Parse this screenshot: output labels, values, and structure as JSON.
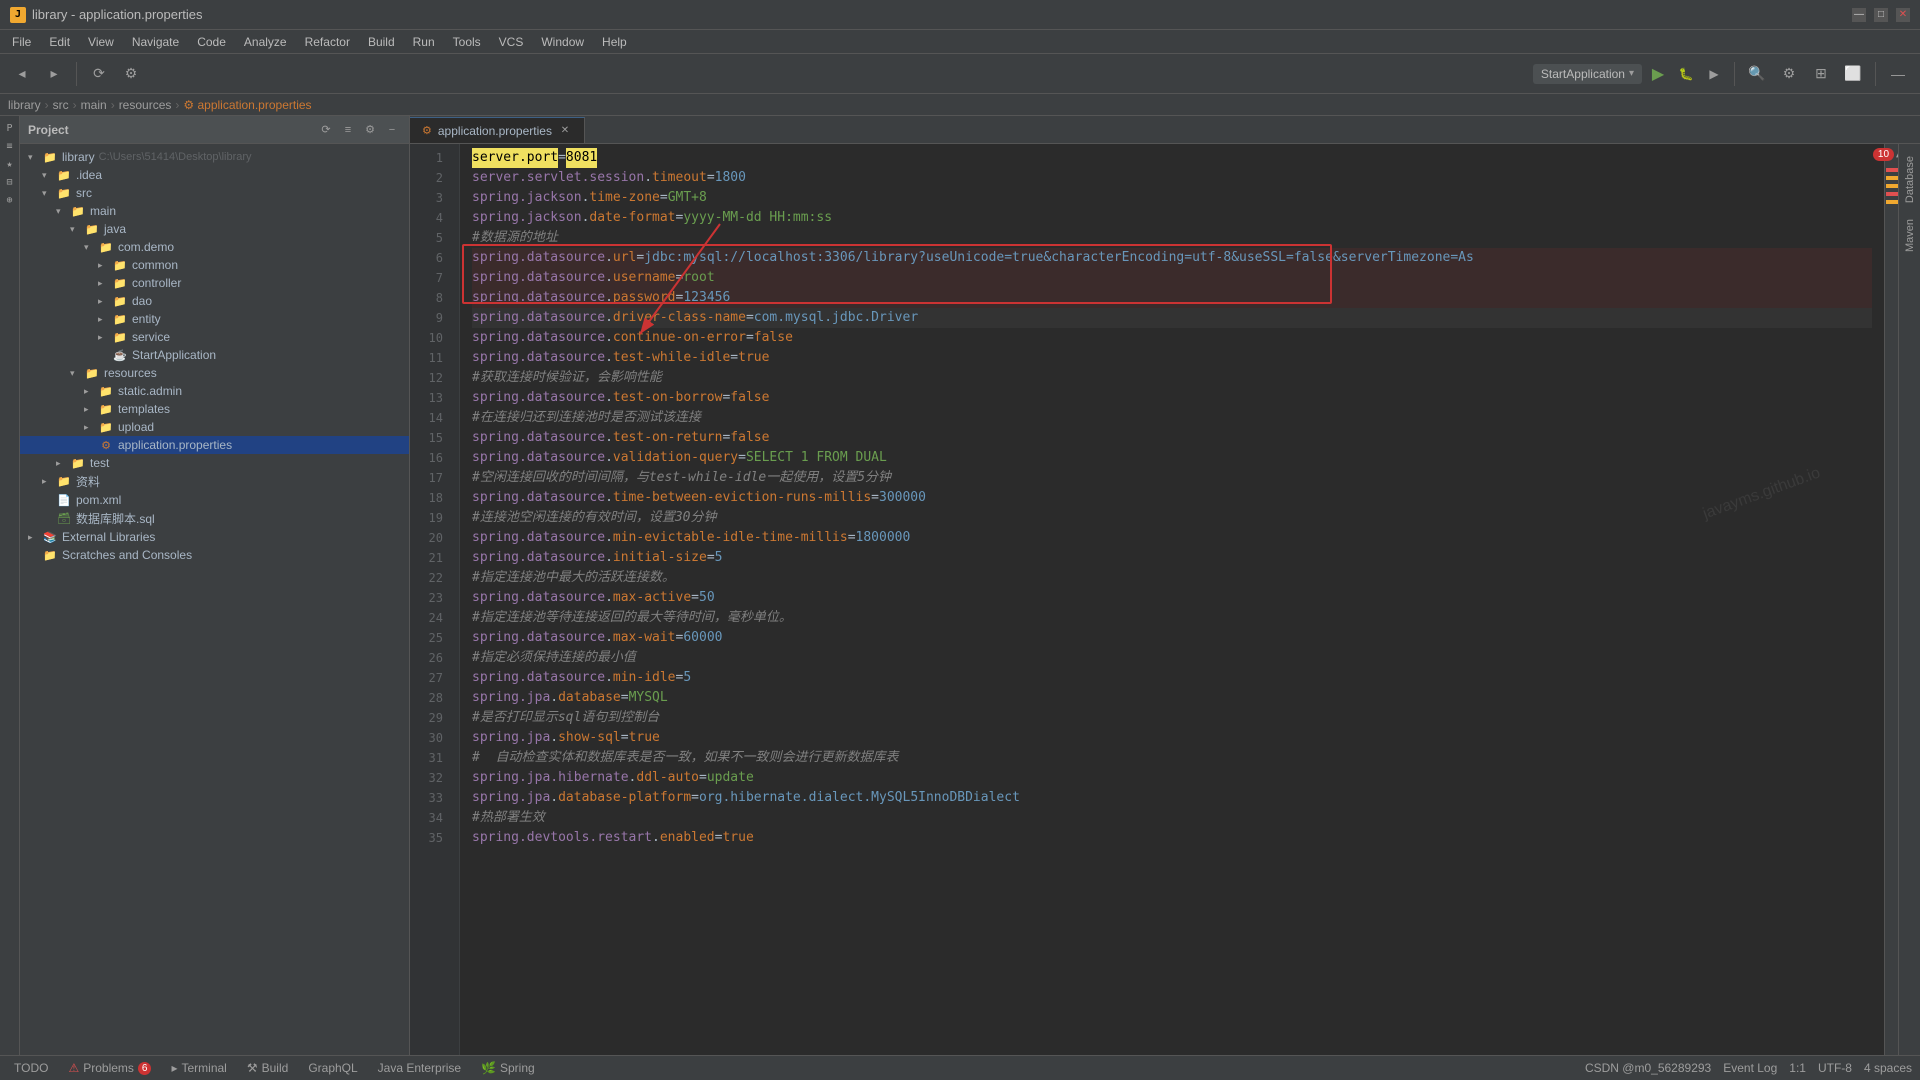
{
  "titlebar": {
    "title": "library - application.properties",
    "minimize_label": "—",
    "maximize_label": "□",
    "close_label": "✕"
  },
  "menubar": {
    "items": [
      "File",
      "Edit",
      "View",
      "Navigate",
      "Code",
      "Analyze",
      "Refactor",
      "Build",
      "Run",
      "Tools",
      "VCS",
      "Window",
      "Help"
    ]
  },
  "breadcrumb": {
    "parts": [
      "library",
      "src",
      "main",
      "resources",
      "application.properties"
    ]
  },
  "project": {
    "header": "Project",
    "tree": [
      {
        "indent": 0,
        "arrow": "▾",
        "icon": "folder",
        "label": "library",
        "extra": "C:\\Users\\51414\\Desktop\\library",
        "depth": 0
      },
      {
        "indent": 1,
        "arrow": "▾",
        "icon": "folder",
        "label": ".idea",
        "depth": 1
      },
      {
        "indent": 1,
        "arrow": "▾",
        "icon": "folder",
        "label": "src",
        "depth": 1
      },
      {
        "indent": 2,
        "arrow": "▾",
        "icon": "folder",
        "label": "main",
        "depth": 2
      },
      {
        "indent": 3,
        "arrow": "▾",
        "icon": "folder",
        "label": "java",
        "depth": 3
      },
      {
        "indent": 4,
        "arrow": "▾",
        "icon": "folder",
        "label": "com.demo",
        "depth": 4
      },
      {
        "indent": 5,
        "arrow": "▸",
        "icon": "folder",
        "label": "common",
        "depth": 5
      },
      {
        "indent": 5,
        "arrow": "▸",
        "icon": "folder",
        "label": "controller",
        "depth": 5
      },
      {
        "indent": 5,
        "arrow": "▸",
        "icon": "folder",
        "label": "dao",
        "depth": 5
      },
      {
        "indent": 5,
        "arrow": "▸",
        "icon": "folder",
        "label": "entity",
        "depth": 5
      },
      {
        "indent": 5,
        "arrow": "▸",
        "icon": "folder",
        "label": "service",
        "depth": 5
      },
      {
        "indent": 5,
        "arrow": "",
        "icon": "java",
        "label": "StartApplication",
        "depth": 5
      },
      {
        "indent": 3,
        "arrow": "▾",
        "icon": "folder",
        "label": "resources",
        "depth": 3
      },
      {
        "indent": 4,
        "arrow": "▸",
        "icon": "folder",
        "label": "static.admin",
        "depth": 4
      },
      {
        "indent": 4,
        "arrow": "▸",
        "icon": "folder",
        "label": "templates",
        "depth": 4
      },
      {
        "indent": 4,
        "arrow": "▸",
        "icon": "folder",
        "label": "upload",
        "depth": 4
      },
      {
        "indent": 4,
        "arrow": "",
        "icon": "properties",
        "label": "application.properties",
        "depth": 4,
        "selected": true
      },
      {
        "indent": 2,
        "arrow": "▸",
        "icon": "folder",
        "label": "test",
        "depth": 2
      },
      {
        "indent": 1,
        "arrow": "▸",
        "icon": "folder",
        "label": "资料",
        "depth": 1
      },
      {
        "indent": 1,
        "arrow": "",
        "icon": "xml",
        "label": "pom.xml",
        "depth": 1
      },
      {
        "indent": 1,
        "arrow": "",
        "icon": "sql",
        "label": "数据库脚本.sql",
        "depth": 1
      },
      {
        "indent": 0,
        "arrow": "▸",
        "icon": "lib",
        "label": "External Libraries",
        "depth": 0
      },
      {
        "indent": 0,
        "arrow": "",
        "icon": "folder",
        "label": "Scratches and Consoles",
        "depth": 0
      }
    ]
  },
  "editor": {
    "tab_label": "application.properties",
    "lines": [
      {
        "n": 1,
        "text": "server.port=8081",
        "highlight_port": true
      },
      {
        "n": 2,
        "text": "server.servlet.session.timeout=1800"
      },
      {
        "n": 3,
        "text": "spring.jackson.time-zone=GMT+8"
      },
      {
        "n": 4,
        "text": "spring.jackson.date-format=yyyy-MM-dd HH:mm:ss"
      },
      {
        "n": 5,
        "text": "#数据源的地址",
        "comment": true
      },
      {
        "n": 6,
        "text": "spring.datasource.url=jdbc:mysql://localhost:3306/library?useUnicode=true&characterEncoding=utf-8&useSSL=false&serverTimezone=As",
        "redbox": true
      },
      {
        "n": 7,
        "text": "spring.datasource.username=root",
        "redbox": true
      },
      {
        "n": 8,
        "text": "spring.datasource.password=123456",
        "redbox": true
      },
      {
        "n": 9,
        "text": "spring.datasource.driver-class-name=com.mysql.jdbc.Driver",
        "current": true
      },
      {
        "n": 10,
        "text": "spring.datasource.continue-on-error=false"
      },
      {
        "n": 11,
        "text": "spring.datasource.test-while-idle=true"
      },
      {
        "n": 12,
        "text": "#获取连接时候验证，会影响性能",
        "comment": true
      },
      {
        "n": 13,
        "text": "spring.datasource.test-on-borrow=false"
      },
      {
        "n": 14,
        "text": "#在连接归还到连接池时是否测试该连接",
        "comment": true
      },
      {
        "n": 15,
        "text": "spring.datasource.test-on-return=false"
      },
      {
        "n": 16,
        "text": "spring.datasource.validation-query=SELECT 1 FROM DUAL"
      },
      {
        "n": 17,
        "text": "#空闲连接回收的时间间隔，与test-while-idle一起使用，设置5分钟",
        "comment": true
      },
      {
        "n": 18,
        "text": "spring.datasource.time-between-eviction-runs-millis=300000"
      },
      {
        "n": 19,
        "text": "#连接池空闲连接的有效时间，设置30分钟",
        "comment": true
      },
      {
        "n": 20,
        "text": "spring.datasource.min-evictable-idle-time-millis=1800000"
      },
      {
        "n": 21,
        "text": "spring.datasource.initial-size=5"
      },
      {
        "n": 22,
        "text": "#指定连接池中最大的活跃连接数。",
        "comment": true
      },
      {
        "n": 23,
        "text": "spring.datasource.max-active=50"
      },
      {
        "n": 24,
        "text": "#指定连接池等待连接返回的最大等待时间，毫秒单位。",
        "comment": true
      },
      {
        "n": 25,
        "text": "spring.datasource.max-wait=60000"
      },
      {
        "n": 26,
        "text": "#指定必须保持连接的最小值",
        "comment": true
      },
      {
        "n": 27,
        "text": "spring.datasource.min-idle=5"
      },
      {
        "n": 28,
        "text": "spring.jpa.database=MYSQL"
      },
      {
        "n": 29,
        "text": "#是否打印显示sql语句到控制台",
        "comment": true
      },
      {
        "n": 30,
        "text": "spring.jpa.show-sql=true"
      },
      {
        "n": 31,
        "text": "#  自动检查实体和数据库表是否一致，如果不一致则会进行更新数据库表",
        "comment": true
      },
      {
        "n": 32,
        "text": "spring.jpa.hibernate.ddl-auto=update"
      },
      {
        "n": 33,
        "text": "spring.jpa.database-platform=org.hibernate.dialect.MySQL5InnoDBDialect"
      },
      {
        "n": 34,
        "text": "#热部署生效",
        "comment": true
      },
      {
        "n": 35,
        "text": "spring.devtools.restart.enabled=true"
      }
    ]
  },
  "bottombar": {
    "todo": "TODO",
    "problems": "Problems",
    "problems_count": "6",
    "terminal": "Terminal",
    "build": "Build",
    "graphql": "GraphQL",
    "java_enterprise": "Java Enterprise",
    "spring": "Spring",
    "status_line": "1:1",
    "encoding": "UTF-8",
    "indent": "4 spaces",
    "git": "CSDN @m0_56289293"
  },
  "right_panel": {
    "database": "Database",
    "maven": "Maven"
  },
  "watermark": "javayms.github.io",
  "error_count": "10",
  "run_config": "StartApplication"
}
